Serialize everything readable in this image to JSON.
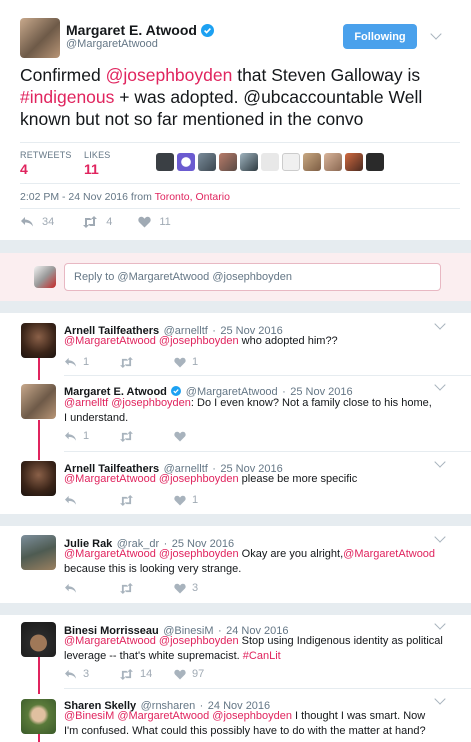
{
  "main_tweet": {
    "display_name": "Margaret E. Atwood",
    "handle": "@MargaretAtwood",
    "follow_label": "Following",
    "text_parts": [
      "Confirmed ",
      "@josephboyden",
      " that Steven Galloway is ",
      "#indigenous",
      " + was adopted. @ubcaccountable Well known but not so far mentioned in the convo"
    ],
    "retweets_label": "RETWEETS",
    "retweets_count": "4",
    "likes_label": "LIKES",
    "likes_count": "11",
    "timestamp": "2:02 PM - 24 Nov 2016 from ",
    "location": "Toronto, Ontario",
    "reply_count": "34",
    "retweet_count_small": "4",
    "like_count_small": "11"
  },
  "reply_box": {
    "placeholder": "Reply to @MargaretAtwood @josephboyden"
  },
  "replies": [
    {
      "name": "Arnell Tailfeathers",
      "handle": "@arnelltf",
      "date": "25 Nov 2016",
      "mentions": "@MargaretAtwood @josephboyden",
      "text": " who adopted him??",
      "reply_count": "1",
      "retweet_count": "",
      "like_count": "1"
    },
    {
      "name": "Margaret E. Atwood",
      "handle": "@MargaretAtwood",
      "date": "25 Nov 2016",
      "mentions": "@arnelltf @josephboyden",
      "text": ": Do I even know? Not a family close to his home, I understand.",
      "reply_count": "1",
      "retweet_count": "",
      "like_count": ""
    },
    {
      "name": "Arnell Tailfeathers",
      "handle": "@arnelltf",
      "date": "25 Nov 2016",
      "mentions": "@MargaretAtwood @josephboyden",
      "text": " please be more specific",
      "reply_count": "",
      "retweet_count": "",
      "like_count": "1"
    },
    {
      "name": "Julie Rak",
      "handle": "@rak_dr",
      "date": "25 Nov 2016",
      "mentions": "@MargaretAtwood @josephboyden",
      "text": " Okay are you alright,",
      "mention_end": "@MargaretAtwood",
      "text2": "because this is looking very strange.",
      "reply_count": "",
      "retweet_count": "",
      "like_count": "3"
    },
    {
      "name": "Binesi Morrisseau",
      "handle": "@BinesiM",
      "date": "24 Nov 2016",
      "mentions": "@MargaretAtwood @josephboyden",
      "text": " Stop using Indigenous identity as political leverage -- that's white supremacist. ",
      "hashtag": "#CanLit",
      "reply_count": "3",
      "retweet_count": "14",
      "like_count": "97"
    },
    {
      "name": "Sharen Skelly",
      "handle": "@rnsharen",
      "date": "24 Nov 2016",
      "mentions": "@BinesiM @MargaretAtwood @josephboyden",
      "text": " I thought I was smart. Now I'm confused. What could this possibly have to do with the matter at hand?"
    }
  ]
}
